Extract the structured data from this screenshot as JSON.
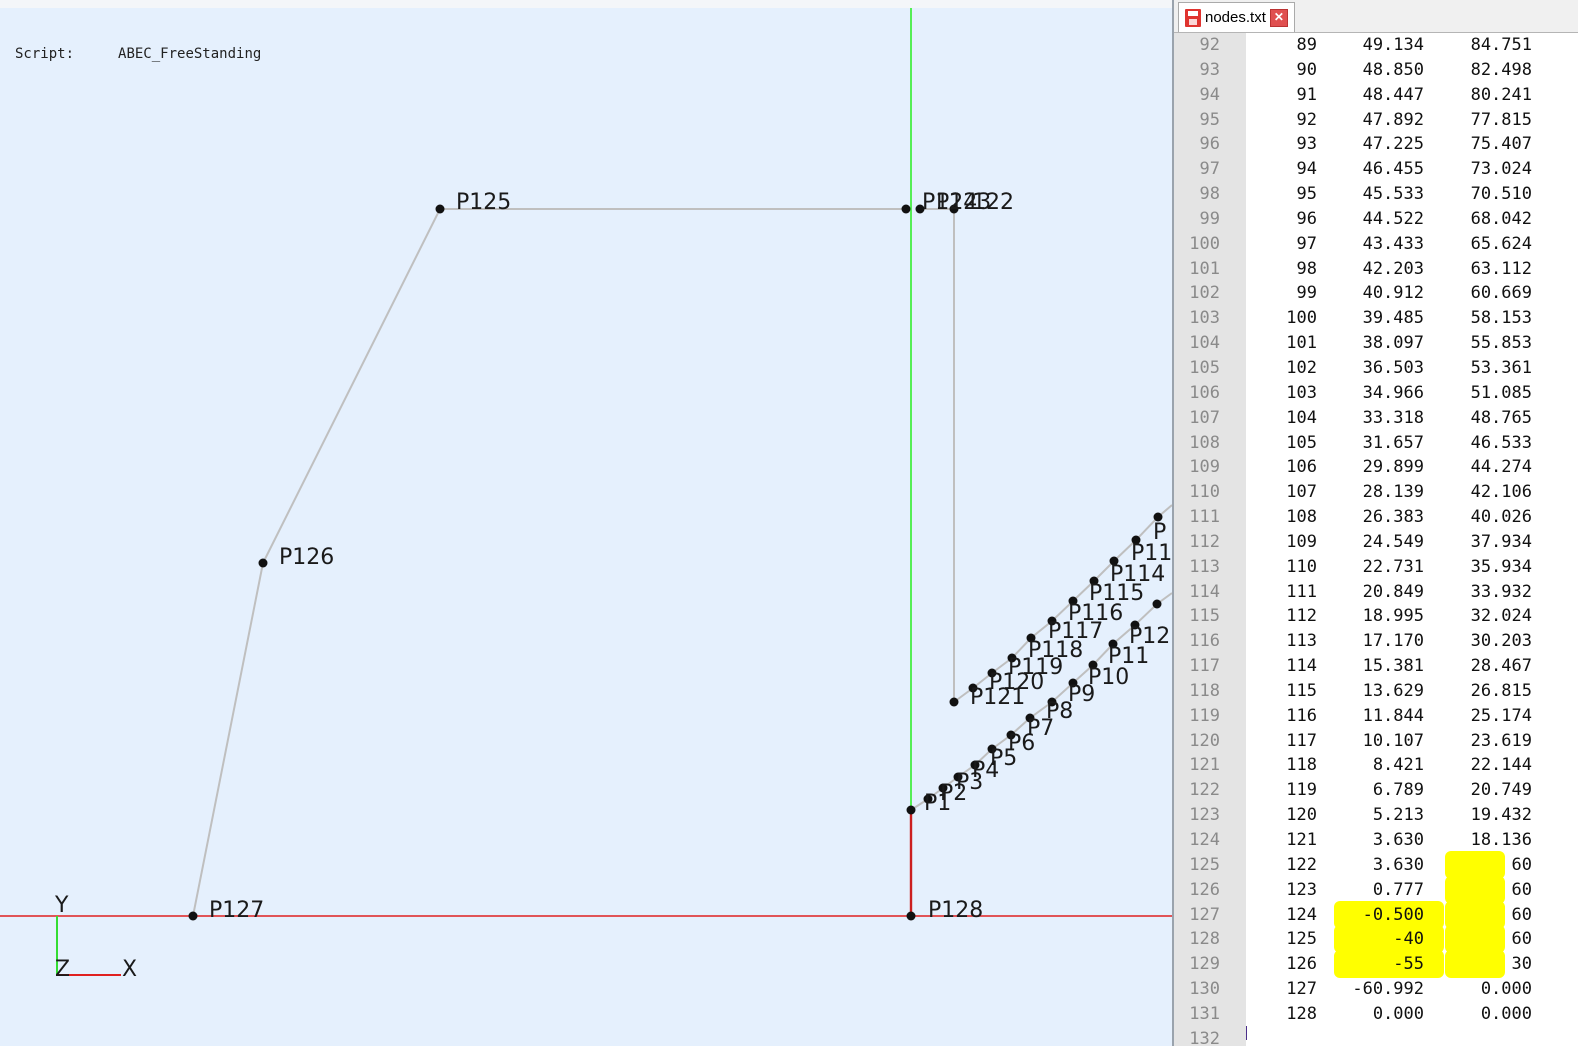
{
  "viewport": {
    "script_key": "Script:",
    "script_value": "ABEC_FreeStanding",
    "axes": {
      "y": "Y",
      "z": "Z",
      "x": "X"
    },
    "colors": {
      "background": "#e5f0fd",
      "x_axis": "#e02020",
      "y_axis": "#33dd33",
      "line": "#bfbfbf",
      "node": "#111111"
    },
    "points": {
      "p125": "P125",
      "p126": "P126",
      "p127": "P127",
      "p128": "P128",
      "top_cluster": "P12̶4P3122",
      "p121": "P121",
      "p120": "P120",
      "p119": "P119",
      "p118": "P118",
      "p117": "P117",
      "p116": "P116",
      "p115": "P115",
      "p114": "P114",
      "p113": "P11",
      "p112": "P",
      "p12": "P12",
      "p11": "P11",
      "p10": "P10",
      "p9": "P9",
      "p8": "P8",
      "p7": "P7",
      "p6": "P6",
      "p5": "P5",
      "p4": "P4",
      "p3": "P3",
      "p2": "P2",
      "p1": "P1"
    }
  },
  "editor": {
    "tab_label": "nodes.txt",
    "tab_icon": "save-icon",
    "rows": [
      {
        "ln": "92",
        "id": "89",
        "x": "49.134",
        "y": "84.751"
      },
      {
        "ln": "93",
        "id": "90",
        "x": "48.850",
        "y": "82.498"
      },
      {
        "ln": "94",
        "id": "91",
        "x": "48.447",
        "y": "80.241"
      },
      {
        "ln": "95",
        "id": "92",
        "x": "47.892",
        "y": "77.815"
      },
      {
        "ln": "96",
        "id": "93",
        "x": "47.225",
        "y": "75.407"
      },
      {
        "ln": "97",
        "id": "94",
        "x": "46.455",
        "y": "73.024"
      },
      {
        "ln": "98",
        "id": "95",
        "x": "45.533",
        "y": "70.510"
      },
      {
        "ln": "99",
        "id": "96",
        "x": "44.522",
        "y": "68.042"
      },
      {
        "ln": "100",
        "id": "97",
        "x": "43.433",
        "y": "65.624"
      },
      {
        "ln": "101",
        "id": "98",
        "x": "42.203",
        "y": "63.112"
      },
      {
        "ln": "102",
        "id": "99",
        "x": "40.912",
        "y": "60.669"
      },
      {
        "ln": "103",
        "id": "100",
        "x": "39.485",
        "y": "58.153"
      },
      {
        "ln": "104",
        "id": "101",
        "x": "38.097",
        "y": "55.853"
      },
      {
        "ln": "105",
        "id": "102",
        "x": "36.503",
        "y": "53.361"
      },
      {
        "ln": "106",
        "id": "103",
        "x": "34.966",
        "y": "51.085"
      },
      {
        "ln": "107",
        "id": "104",
        "x": "33.318",
        "y": "48.765"
      },
      {
        "ln": "108",
        "id": "105",
        "x": "31.657",
        "y": "46.533"
      },
      {
        "ln": "109",
        "id": "106",
        "x": "29.899",
        "y": "44.274"
      },
      {
        "ln": "110",
        "id": "107",
        "x": "28.139",
        "y": "42.106"
      },
      {
        "ln": "111",
        "id": "108",
        "x": "26.383",
        "y": "40.026"
      },
      {
        "ln": "112",
        "id": "109",
        "x": "24.549",
        "y": "37.934"
      },
      {
        "ln": "113",
        "id": "110",
        "x": "22.731",
        "y": "35.934"
      },
      {
        "ln": "114",
        "id": "111",
        "x": "20.849",
        "y": "33.932"
      },
      {
        "ln": "115",
        "id": "112",
        "x": "18.995",
        "y": "32.024"
      },
      {
        "ln": "116",
        "id": "113",
        "x": "17.170",
        "y": "30.203"
      },
      {
        "ln": "117",
        "id": "114",
        "x": "15.381",
        "y": "28.467"
      },
      {
        "ln": "118",
        "id": "115",
        "x": "13.629",
        "y": "26.815"
      },
      {
        "ln": "119",
        "id": "116",
        "x": "11.844",
        "y": "25.174"
      },
      {
        "ln": "120",
        "id": "117",
        "x": "10.107",
        "y": "23.619"
      },
      {
        "ln": "121",
        "id": "118",
        "x": "8.421",
        "y": "22.144"
      },
      {
        "ln": "122",
        "id": "119",
        "x": "6.789",
        "y": "20.749"
      },
      {
        "ln": "123",
        "id": "120",
        "x": "5.213",
        "y": "19.432"
      },
      {
        "ln": "124",
        "id": "121",
        "x": "3.630",
        "y": "18.136"
      },
      {
        "ln": "125",
        "id": "122",
        "x": "3.630",
        "y": "60",
        "hl_y": true
      },
      {
        "ln": "126",
        "id": "123",
        "x": "0.777",
        "y": "60",
        "hl_y": true
      },
      {
        "ln": "127",
        "id": "124",
        "x": "-0.500",
        "y": "60",
        "hl_x": true,
        "hl_y": true
      },
      {
        "ln": "128",
        "id": "125",
        "x": "-40",
        "y": "60",
        "hl_x": true,
        "hl_y": true
      },
      {
        "ln": "129",
        "id": "126",
        "x": "-55",
        "y": "30",
        "hl_x": true,
        "hl_y": true
      },
      {
        "ln": "130",
        "id": "127",
        "x": "-60.992",
        "y": "0.000"
      },
      {
        "ln": "131",
        "id": "128",
        "x": "0.000",
        "y": "0.000"
      },
      {
        "ln": "132",
        "id": "",
        "x": "",
        "y": ""
      }
    ],
    "highlight_color": "#ffff00"
  }
}
